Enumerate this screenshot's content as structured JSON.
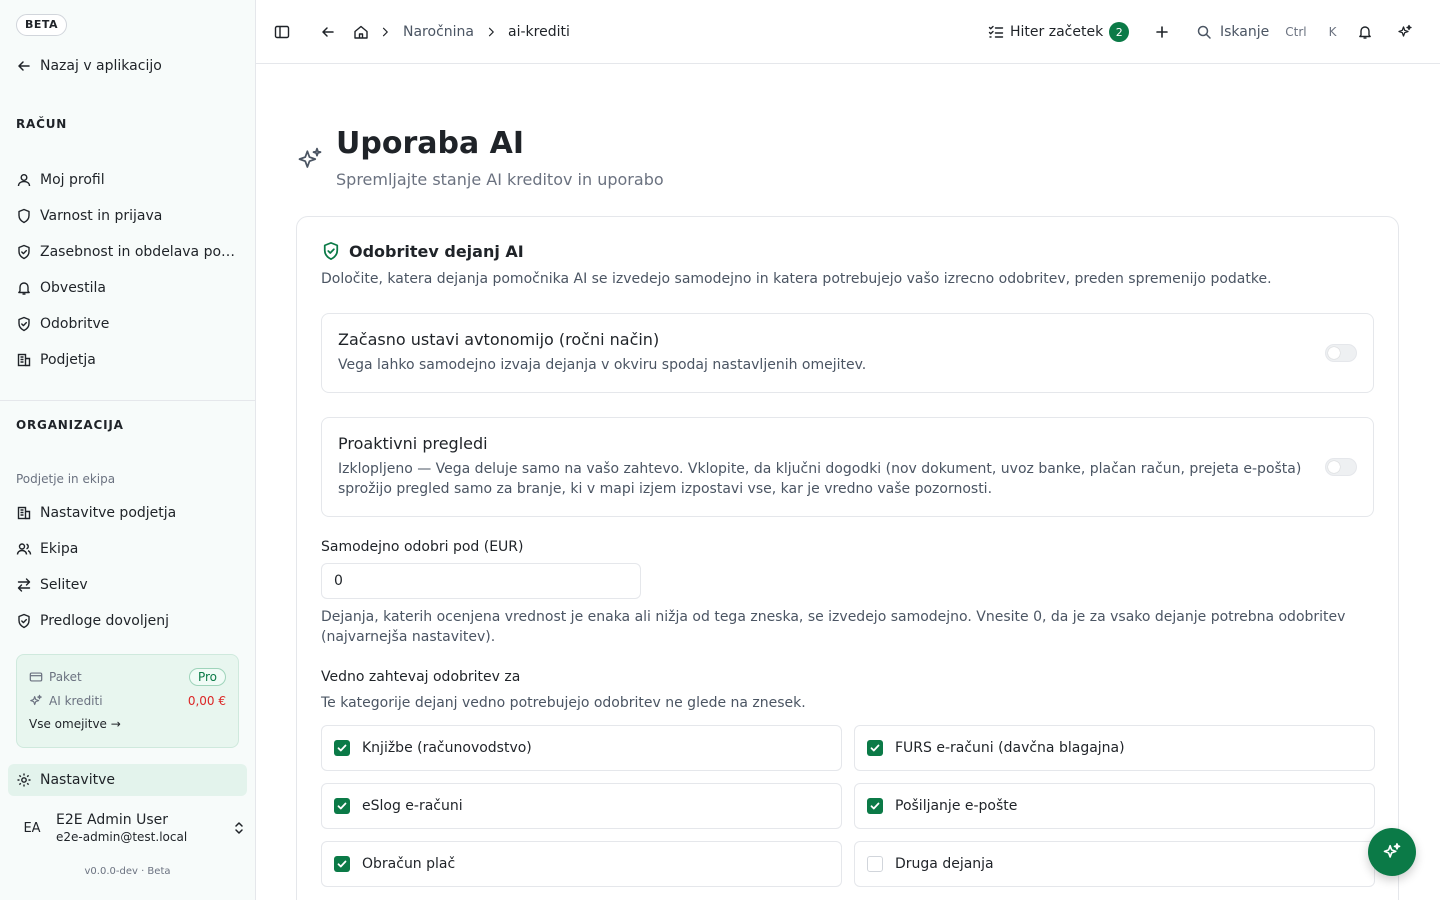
{
  "sidebar": {
    "beta_badge": "BETA",
    "back_label": "Nazaj v aplikacijo",
    "account_title": "RAČUN",
    "account_items": [
      {
        "label": "Moj profil",
        "icon": "user-icon"
      },
      {
        "label": "Varnost in prijava",
        "icon": "shield-icon"
      },
      {
        "label": "Zasebnost in obdelava podatkov",
        "icon": "shield-check-icon"
      },
      {
        "label": "Obvestila",
        "icon": "bell-icon"
      },
      {
        "label": "Odobritve",
        "icon": "shield-check-icon"
      },
      {
        "label": "Podjetja",
        "icon": "building-icon"
      }
    ],
    "org_title": "ORGANIZACIJA",
    "org_group_label": "Podjetje in ekipa",
    "org_items": [
      {
        "label": "Nastavitve podjetja",
        "icon": "building-icon"
      },
      {
        "label": "Ekipa",
        "icon": "users-icon"
      },
      {
        "label": "Selitev",
        "icon": "arrows-swap-icon"
      },
      {
        "label": "Predloge dovoljenj",
        "icon": "shield-check-icon"
      }
    ],
    "plan": {
      "plan_label": "Paket",
      "plan_value": "Pro",
      "credits_label": "AI krediti",
      "credits_value": "0,00 €",
      "limits_link": "Vse omejitve →"
    },
    "settings_label": "Nastavitve",
    "user": {
      "initials": "EA",
      "name": "E2E Admin User",
      "email": "e2e-admin@test.local"
    },
    "version": "v0.0.0-dev · Beta"
  },
  "topbar": {
    "breadcrumb": [
      "Naročnina",
      "ai-krediti"
    ],
    "quick_start_label": "Hiter začetek",
    "quick_start_count": "2",
    "search_label": "Iskanje",
    "search_kbd_1": "Ctrl",
    "search_kbd_2": "K"
  },
  "page": {
    "title": "Uporaba AI",
    "subtitle": "Spremljajte stanje AI kreditov in uporabo"
  },
  "card": {
    "title": "Odobritev dejanj AI",
    "description": "Določite, katera dejanja pomočnika AI se izvedejo samodejno in katera potrebujejo vašo izrecno odobritev, preden spremenijo podatke.",
    "autonomy": {
      "title": "Začasno ustavi avtonomijo (ročni način)",
      "desc": "Vega lahko samodejno izvaja dejanja v okviru spodaj nastavljenih omejitev.",
      "enabled": false
    },
    "proactive": {
      "title": "Proaktivni pregledi",
      "desc": "Izklopljeno — Vega deluje samo na vašo zahtevo. Vklopite, da ključni dogodki (nov dokument, uvoz banke, plačan račun, prejeta e-pošta) sprožijo pregled samo za branje, ki v mapi izjem izpostavi vse, kar je vredno vaše pozornosti.",
      "enabled": false
    },
    "threshold_label": "Samodejno odobri pod (EUR)",
    "threshold_value": "0",
    "threshold_help": "Dejanja, katerih ocenjena vrednost je enaka ali nižja od tega zneska, se izvedejo samodejno. Vnesite 0, da je za vsako dejanje potrebna odobritev (najvarnejša nastavitev).",
    "categories_label": "Vedno zahtevaj odobritev za",
    "categories_sub": "Te kategorije dejanj vedno potrebujejo odobritev ne glede na znesek.",
    "categories": [
      {
        "label": "Knjižbe (računovodstvo)",
        "checked": true
      },
      {
        "label": "FURS e-računi (davčna blagajna)",
        "checked": true
      },
      {
        "label": "eSlog e-računi",
        "checked": true
      },
      {
        "label": "Pošiljanje e-pošte",
        "checked": true
      },
      {
        "label": "Obračun plač",
        "checked": true
      },
      {
        "label": "Druga dejanja",
        "checked": false
      }
    ]
  },
  "colors": {
    "accent": "#0b7a47",
    "danger": "#dc2626",
    "sidebar_bg": "#f7fbfa"
  }
}
